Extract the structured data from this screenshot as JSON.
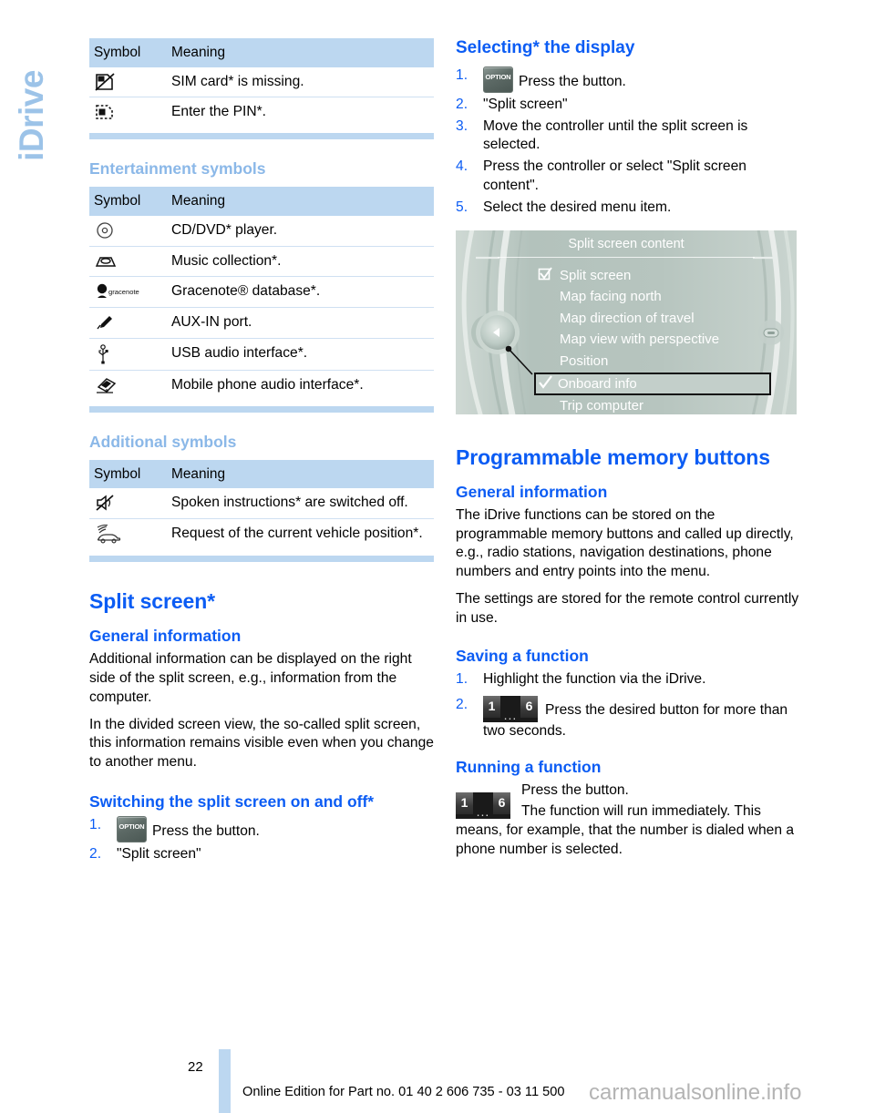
{
  "side_tab": {
    "label": "iDrive"
  },
  "left_column": {
    "phone_table": {
      "headers": [
        "Symbol",
        "Meaning"
      ],
      "rows": [
        {
          "icon": "sim-card-missing-icon",
          "meaning": "SIM card* is missing."
        },
        {
          "icon": "enter-pin-icon",
          "meaning": "Enter the PIN*."
        }
      ]
    },
    "entertainment": {
      "heading": "Entertainment symbols",
      "headers": [
        "Symbol",
        "Meaning"
      ],
      "rows": [
        {
          "icon": "cd-dvd-icon",
          "meaning": "CD/DVD* player."
        },
        {
          "icon": "music-collection-icon",
          "meaning": "Music collection*."
        },
        {
          "icon": "gracenote-icon",
          "meaning": "Gracenote® database*."
        },
        {
          "icon": "aux-in-icon",
          "meaning": "AUX-IN port."
        },
        {
          "icon": "usb-icon",
          "meaning": "USB audio interface*."
        },
        {
          "icon": "mobile-phone-audio-icon",
          "meaning": "Mobile phone audio interface*."
        }
      ]
    },
    "additional": {
      "heading": "Additional symbols",
      "headers": [
        "Symbol",
        "Meaning"
      ],
      "rows": [
        {
          "icon": "speaker-mute-icon",
          "meaning": "Spoken instructions* are switched off."
        },
        {
          "icon": "vehicle-position-icon",
          "meaning": "Request of the current vehicle position*."
        }
      ]
    },
    "split_screen": {
      "title": "Split screen*",
      "general_heading": "General information",
      "paragraphs": [
        "Additional information can be displayed on the right side of the split screen, e.g., information from the computer.",
        "In the divided screen view, the so-called split screen, this information remains visible even when you change to another menu."
      ],
      "switching_heading": "Switching the split screen on and off*",
      "steps": [
        {
          "icon": "option-button-icon",
          "icon_label": "OPTION",
          "text": "Press the button."
        },
        {
          "text": "\"Split screen\""
        }
      ]
    }
  },
  "right_column": {
    "selecting": {
      "heading": "Selecting* the display",
      "steps": [
        {
          "icon": "option-button-icon",
          "icon_label": "OPTION",
          "text": "Press the button."
        },
        {
          "text": "\"Split screen\""
        },
        {
          "text": "Move the controller until the split screen is selected."
        },
        {
          "text": "Press the controller or select \"Split screen content\"."
        },
        {
          "text": "Select the desired menu item."
        }
      ]
    },
    "idrive_screen": {
      "title": "Split screen content",
      "items": [
        {
          "label": "Split screen",
          "mark": "checkbox-checked-icon"
        },
        {
          "label": "Map facing north",
          "mark": ""
        },
        {
          "label": "Map direction of travel",
          "mark": ""
        },
        {
          "label": "Map view with perspective",
          "mark": ""
        },
        {
          "label": "Position",
          "mark": ""
        },
        {
          "label": "Onboard info",
          "mark": "check-icon",
          "selected": true
        },
        {
          "label": "Trip computer",
          "mark": ""
        }
      ]
    },
    "memory_buttons": {
      "title": "Programmable memory buttons",
      "general_heading": "General information",
      "paragraphs": [
        "The iDrive functions can be stored on the programmable memory buttons and called up directly, e.g., radio stations, navigation destinations, phone numbers and entry points into the menu.",
        "The settings are stored for the remote control currently in use."
      ],
      "saving_heading": "Saving a function",
      "saving_steps": [
        {
          "text": "Highlight the function via the iDrive."
        },
        {
          "icon": "memory-buttons-icon",
          "icon_keys": [
            "1",
            "6"
          ],
          "icon_dots": "...",
          "text": "Press the desired button for more than two seconds."
        }
      ],
      "running_heading": "Running a function",
      "running_icon": "memory-buttons-icon",
      "running_icon_keys": [
        "1",
        "6"
      ],
      "running_icon_dots": "...",
      "running_line1": "Press the button.",
      "running_line2": "The function will run immediately. This means, for example, that the number is dialed when a phone number is selected."
    }
  },
  "footer": {
    "page_number": "22",
    "edition_text": "Online Edition for Part no. 01 40 2 606 735 - 03 11 500",
    "watermark": "carmanualsonline.info"
  },
  "colors": {
    "accent_blue": "#0b5cf4",
    "light_blue": "#8bb8e8",
    "table_header": "#bcd7f0",
    "idrive_bg": "#b9c7c2"
  }
}
